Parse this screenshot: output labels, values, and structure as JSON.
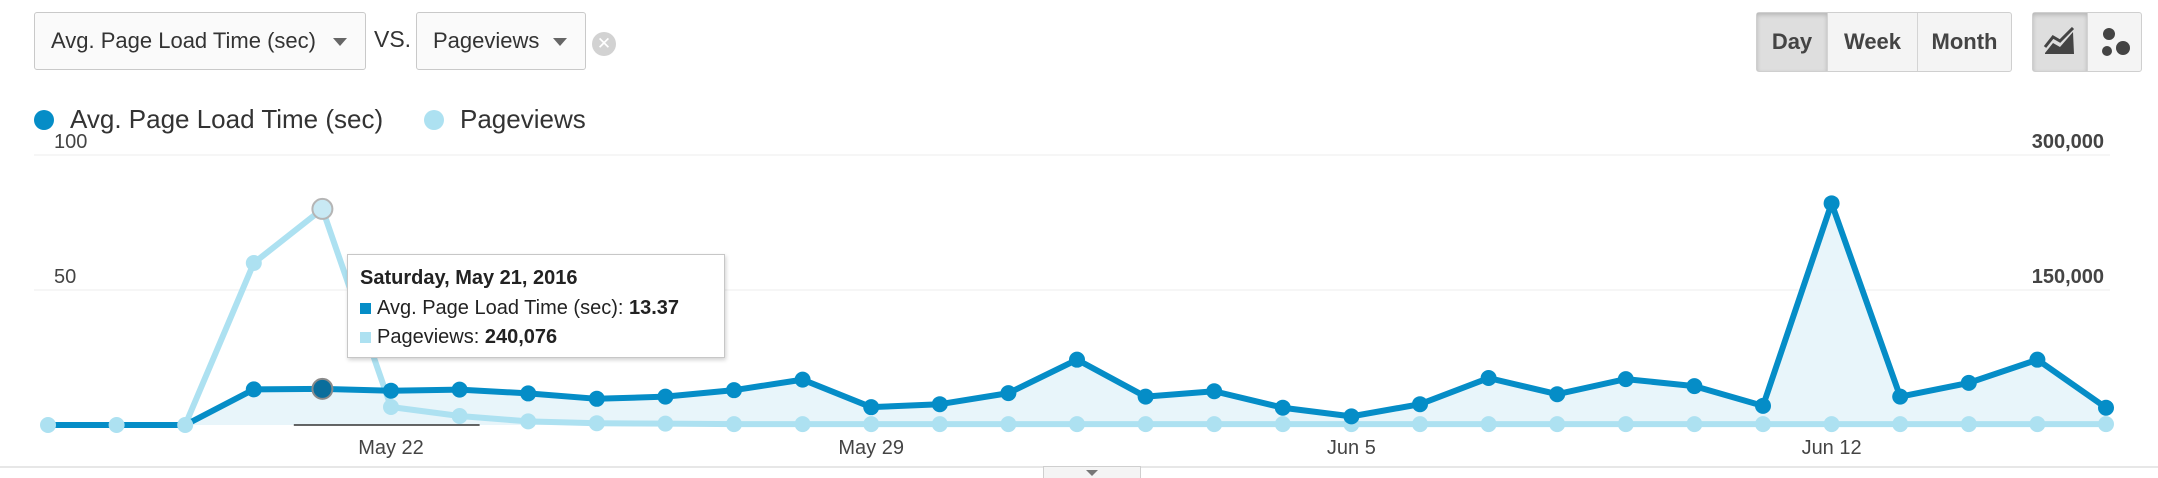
{
  "controls": {
    "metric1": "Avg. Page Load Time (sec)",
    "vs_label": "VS.",
    "metric2": "Pageviews",
    "granularity": [
      "Day",
      "Week",
      "Month"
    ],
    "active_granularity": "Day",
    "chart_type_buttons": [
      "line-chart-icon",
      "motion-chart-icon"
    ],
    "active_chart_type": "line-chart-icon"
  },
  "colors": {
    "primary": "#058dc7",
    "secondary": "#ade1f1",
    "area": "#e6f4fa"
  },
  "tooltip": {
    "date": "Saturday, May 21, 2016",
    "m1_label": "Avg. Page Load Time (sec):",
    "m1_value": "13.37",
    "m2_label": "Pageviews:",
    "m2_value": "240,076"
  },
  "chart_data": {
    "type": "line",
    "x_labels": [
      "May 22",
      "May 29",
      "Jun 5",
      "Jun 12"
    ],
    "x_label_indices": [
      5,
      12,
      19,
      26
    ],
    "n_points": 31,
    "left_axis": {
      "ticks": [
        "100",
        "50"
      ],
      "tick_values": [
        100,
        50
      ],
      "range": [
        0,
        100
      ]
    },
    "right_axis": {
      "ticks": [
        "300,000",
        "150,000"
      ],
      "tick_values": [
        300000,
        150000
      ],
      "range": [
        0,
        300000
      ]
    },
    "series": [
      {
        "name": "Avg. Page Load Time (sec)",
        "axis": "left",
        "values": [
          0,
          0,
          0,
          13.2,
          13.37,
          12.7,
          13.1,
          11.7,
          9.7,
          10.5,
          12.9,
          16.8,
          6.6,
          7.7,
          11.8,
          24.2,
          10.5,
          12.5,
          6.4,
          3.2,
          7.7,
          17.4,
          11.4,
          17.0,
          14.4,
          7.1,
          82.1,
          10.5,
          15.6,
          24.2,
          6.4
        ]
      },
      {
        "name": "Pageviews",
        "axis": "right",
        "values": [
          0,
          0,
          0,
          180000,
          240076,
          20000,
          10000,
          4000,
          2000,
          1500,
          1000,
          1000,
          1000,
          1000,
          1000,
          1000,
          1000,
          1000,
          1000,
          1000,
          1000,
          1000,
          1000,
          1000,
          1000,
          1000,
          1000,
          1000,
          1000,
          1000,
          1000
        ]
      }
    ],
    "highlighted_index": 4,
    "grid": true,
    "legend_position": "top-left"
  }
}
